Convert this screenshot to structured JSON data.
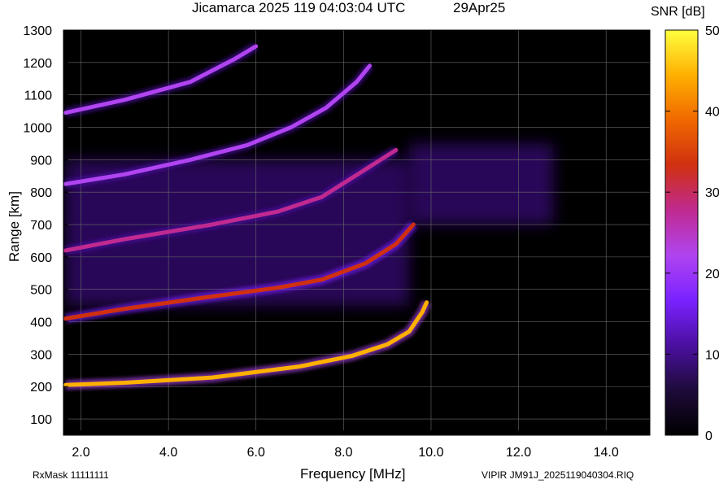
{
  "header": {
    "title": "Jicamarca 2025 119 04:03:04 UTC",
    "date": "29Apr25"
  },
  "footer": {
    "rxmask": "RxMask 11111111",
    "file": "VIPIR  JM91J_2025119040304.RIQ"
  },
  "colors": {
    "background": "#000000",
    "grid": "#6a6a6a",
    "scale": [
      "#000000",
      "#1e0b3a",
      "#4b0fa0",
      "#7a22ff",
      "#b044f0",
      "#c02a90",
      "#d03010",
      "#f06800",
      "#ffb000",
      "#ffff40"
    ]
  },
  "chart_data": {
    "type": "heatmap",
    "title": "Jicamarca 2025 119 04:03:04 UTC",
    "xlabel": "Frequency [MHz]",
    "ylabel": "Range [km]",
    "xlim": [
      1.6,
      15.0
    ],
    "ylim": [
      50,
      1300
    ],
    "x_ticks": [
      "2.0",
      "4.0",
      "6.0",
      "8.0",
      "10.0",
      "12.0",
      "14.0"
    ],
    "x_tick_values": [
      2,
      4,
      6,
      8,
      10,
      12,
      14
    ],
    "y_ticks": [
      "100",
      "200",
      "300",
      "400",
      "500",
      "600",
      "700",
      "800",
      "900",
      "1000",
      "1100",
      "1200",
      "1300"
    ],
    "y_tick_values": [
      100,
      200,
      300,
      400,
      500,
      600,
      700,
      800,
      900,
      1000,
      1100,
      1200,
      1300
    ],
    "colorbar": {
      "label": "SNR [dB]",
      "range": [
        0,
        50
      ],
      "ticks": [
        "0",
        "10",
        "20",
        "30",
        "40",
        "50"
      ],
      "tick_values": [
        0,
        10,
        20,
        30,
        40,
        50
      ]
    },
    "grid": true,
    "traces": [
      {
        "points": [
          [
            1.65,
            205
          ],
          [
            3,
            212
          ],
          [
            5,
            228
          ],
          [
            7,
            262
          ],
          [
            8.2,
            295
          ],
          [
            9,
            330
          ],
          [
            9.5,
            370
          ],
          [
            9.8,
            430
          ],
          [
            9.9,
            460
          ]
        ],
        "snr": 45
      },
      {
        "points": [
          [
            1.65,
            410
          ],
          [
            3,
            440
          ],
          [
            5,
            478
          ],
          [
            6.5,
            505
          ],
          [
            7.5,
            530
          ],
          [
            8.5,
            580
          ],
          [
            9.2,
            640
          ],
          [
            9.6,
            700
          ]
        ],
        "snr": 32
      },
      {
        "points": [
          [
            1.65,
            620
          ],
          [
            3,
            655
          ],
          [
            5,
            700
          ],
          [
            6.5,
            740
          ],
          [
            7.5,
            785
          ],
          [
            8.5,
            870
          ],
          [
            9.2,
            930
          ]
        ],
        "snr": 25
      },
      {
        "points": [
          [
            1.65,
            825
          ],
          [
            3,
            855
          ],
          [
            4.5,
            900
          ],
          [
            5.8,
            945
          ],
          [
            6.8,
            1000
          ],
          [
            7.6,
            1060
          ],
          [
            8.3,
            1140
          ],
          [
            8.6,
            1190
          ]
        ],
        "snr": 24
      },
      {
        "points": [
          [
            1.65,
            1045
          ],
          [
            3,
            1085
          ],
          [
            4.5,
            1140
          ],
          [
            5.5,
            1210
          ],
          [
            6,
            1250
          ]
        ],
        "snr": 22
      }
    ],
    "diffuse": [
      {
        "x": [
          1.65,
          9.5
        ],
        "y": [
          450,
          900
        ],
        "snr": 12
      },
      {
        "x": [
          9.5,
          12.8
        ],
        "y": [
          700,
          950
        ],
        "snr": 9
      }
    ]
  }
}
